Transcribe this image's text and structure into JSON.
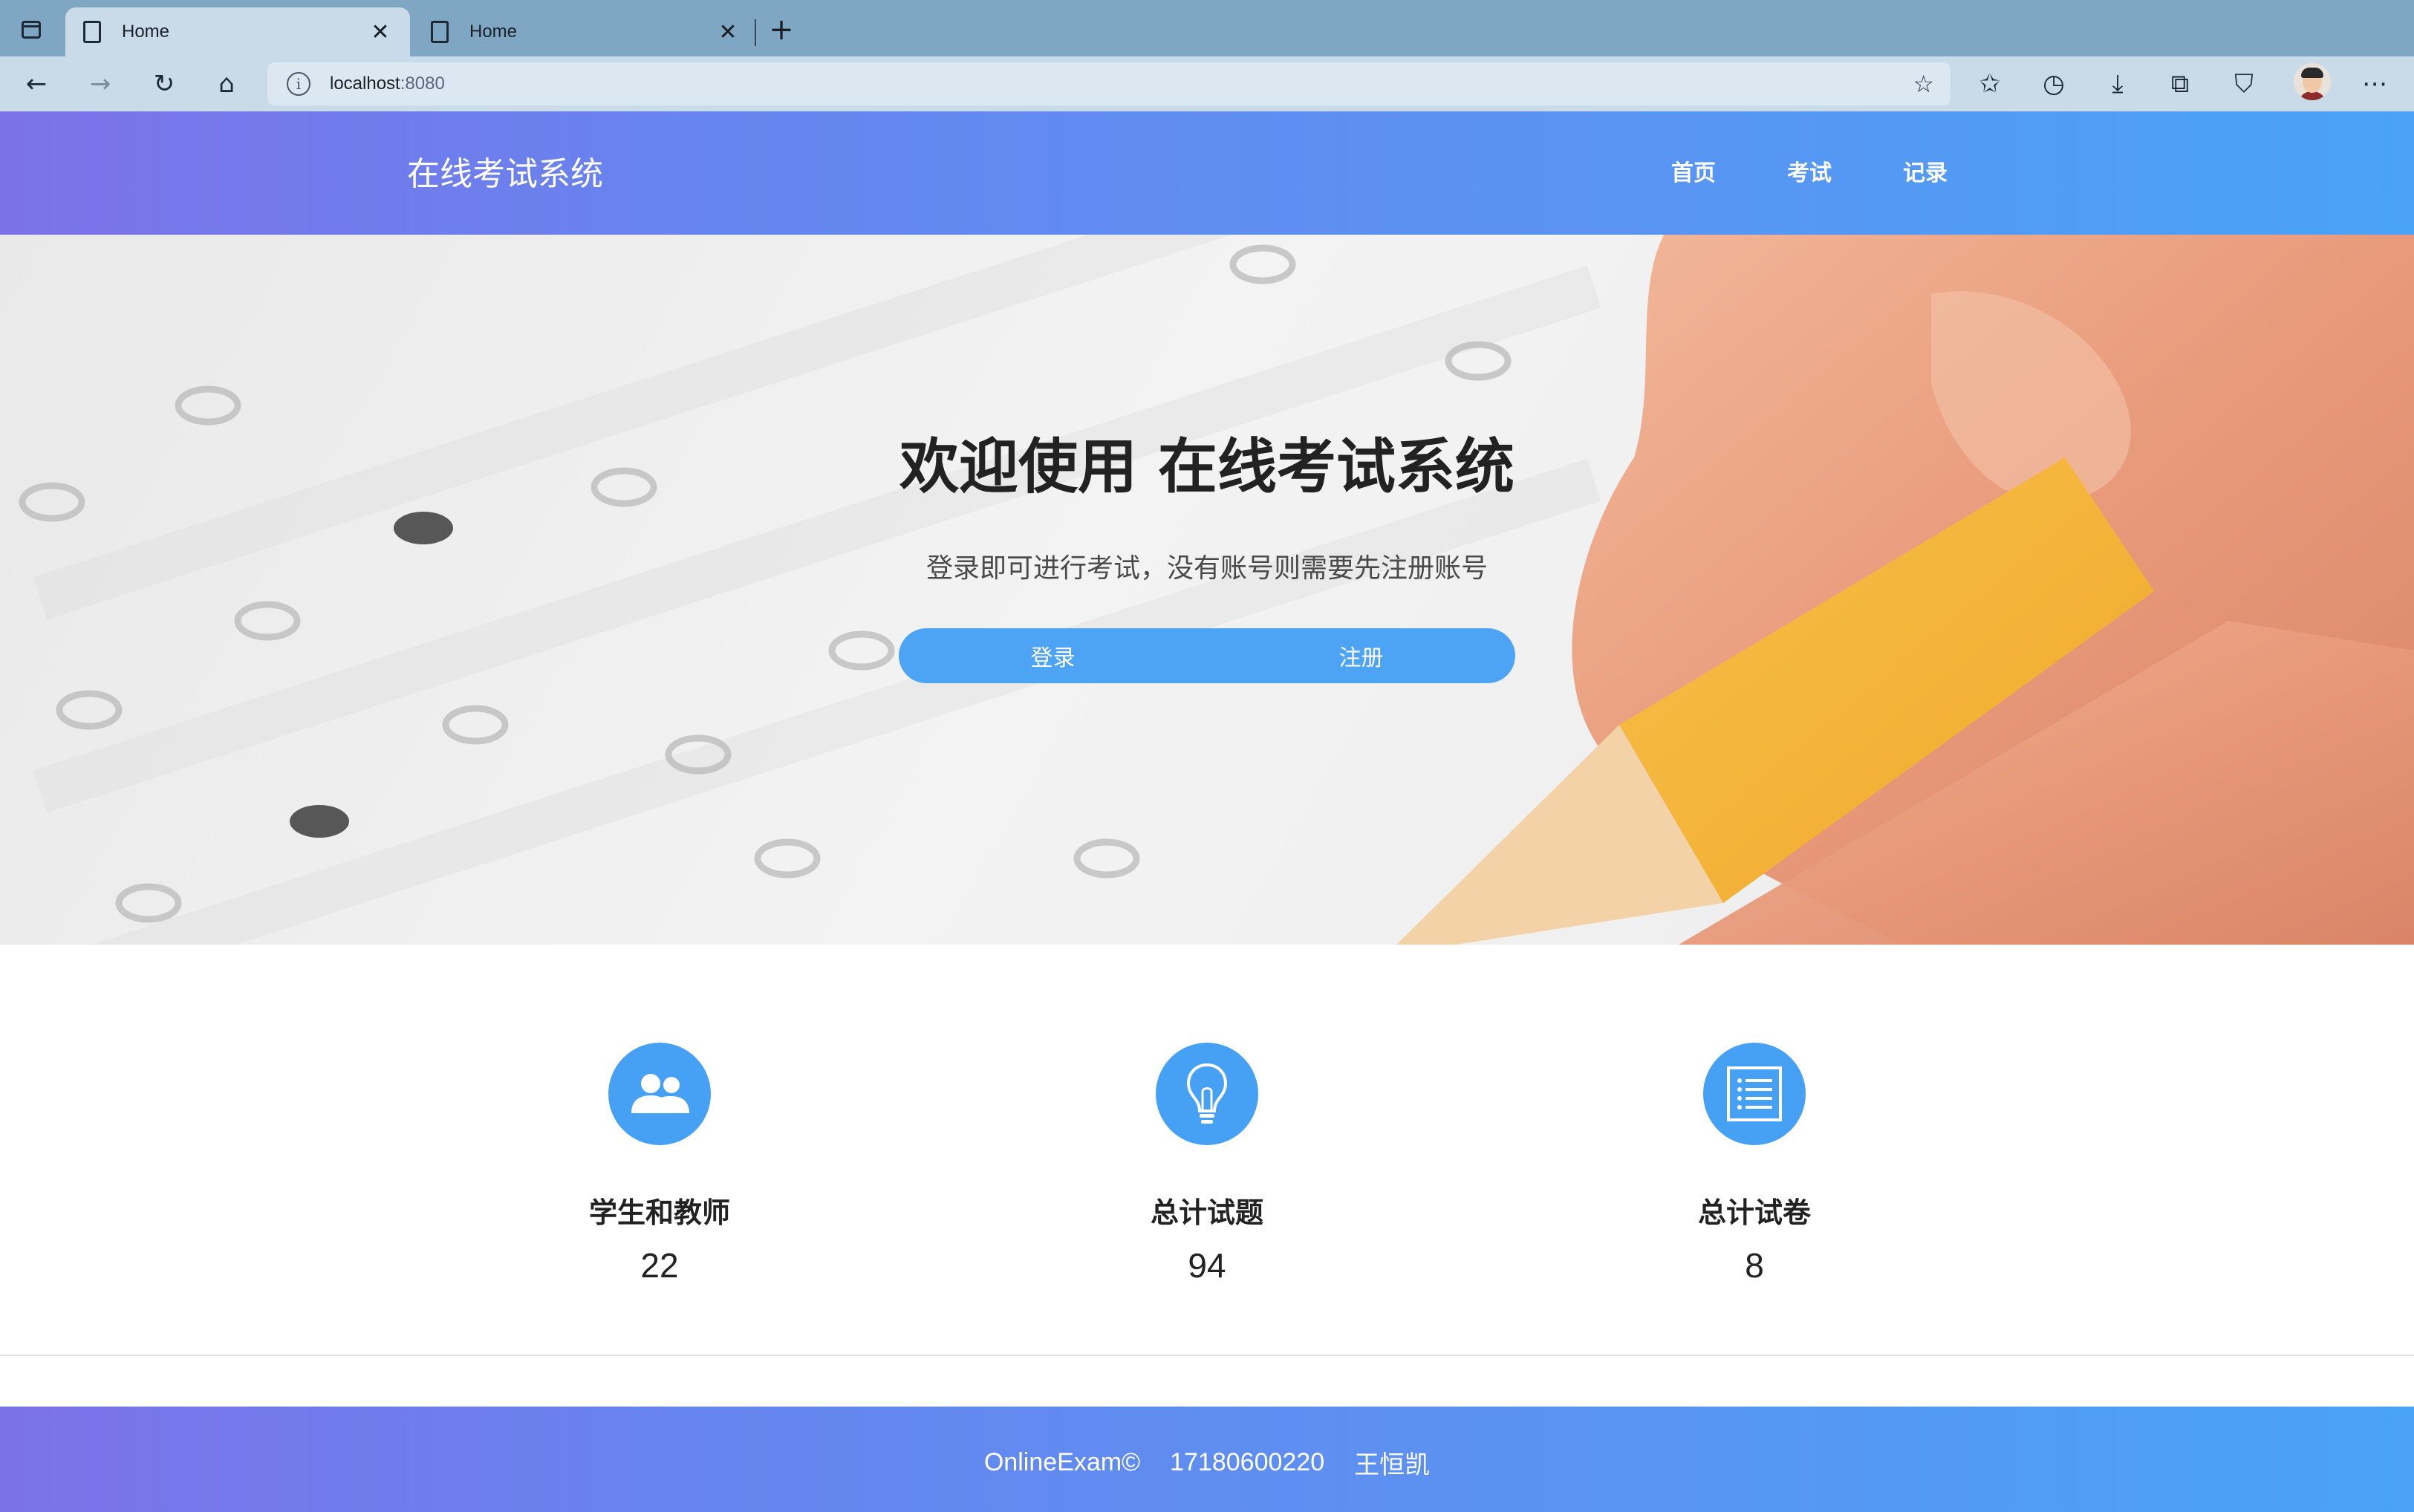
{
  "browser": {
    "tabs": [
      {
        "label": "Home",
        "close": "✕"
      },
      {
        "label": "Home",
        "close": "✕"
      }
    ],
    "new_tab": "+",
    "url_host": "localhost",
    "url_port": ":8080",
    "info": "i"
  },
  "header": {
    "title": "在线考试系统",
    "nav": [
      "首页",
      "考试",
      "记录"
    ]
  },
  "hero": {
    "title": "欢迎使用 在线考试系统",
    "subtitle": "登录即可进行考试，没有账号则需要先注册账号",
    "login_label": "登录",
    "register_label": "注册"
  },
  "stats": [
    {
      "icon": "users-icon",
      "label": "学生和教师",
      "value": "22"
    },
    {
      "icon": "lightbulb-icon",
      "label": "总计试题",
      "value": "94"
    },
    {
      "icon": "list-icon",
      "label": "总计试卷",
      "value": "8"
    }
  ],
  "footer": {
    "brand": "OnlineExam©",
    "student_id": "17180600220",
    "author": "王恒凯"
  },
  "colors": {
    "accent": "#46a1f5",
    "gradient_start": "#7c72e8",
    "gradient_end": "#4aa3f7"
  }
}
